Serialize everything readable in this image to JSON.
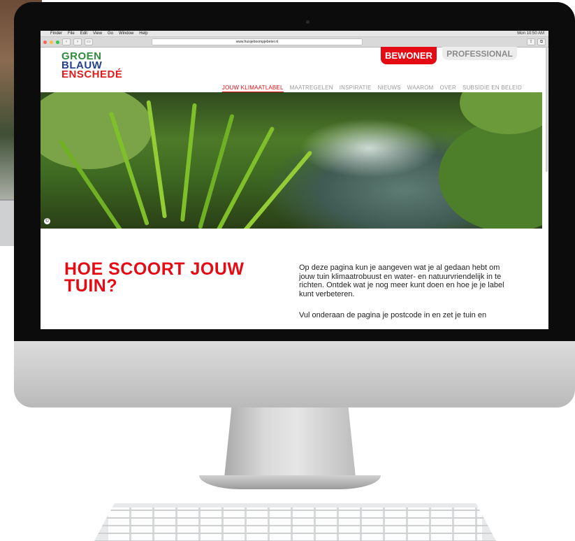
{
  "menubar": {
    "items": [
      "Finder",
      "File",
      "Edit",
      "View",
      "Go",
      "Window",
      "Help"
    ],
    "clock": "Mon 10:50 AM"
  },
  "browser": {
    "url": "www.huisjeboompjebeter.nl"
  },
  "header": {
    "logo_lines": [
      "GROEN",
      "BLAUW",
      "ENSCHEDÉ"
    ],
    "bewoner_label": "BEWONER",
    "professional_label": "PROFESSIONAL",
    "nav": [
      "JOUW KLIMAATLABEL",
      "MAATREGELEN",
      "INSPIRATIE",
      "NIEUWS",
      "WAAROM",
      "OVER",
      "SUBSIDIE EN BELEID"
    ]
  },
  "hero": {
    "copyright_symbol": "©"
  },
  "content": {
    "title": "HOE SCOORT JOUW TUIN?",
    "intro": "Op deze pagina kun je aangeven wat je al gedaan hebt om jouw tuin klimaatrobuust en water- en natuurvriendelijk in te richten. Ontdek wat je nog meer kunt doen en hoe je je label kunt verbeteren.",
    "instruction": "Vul onderaan de pagina je postcode in en zet je tuin en"
  },
  "colors": {
    "accent_red": "#e50b14",
    "logo_green": "#2e8b3d",
    "logo_blue": "#24408e"
  }
}
